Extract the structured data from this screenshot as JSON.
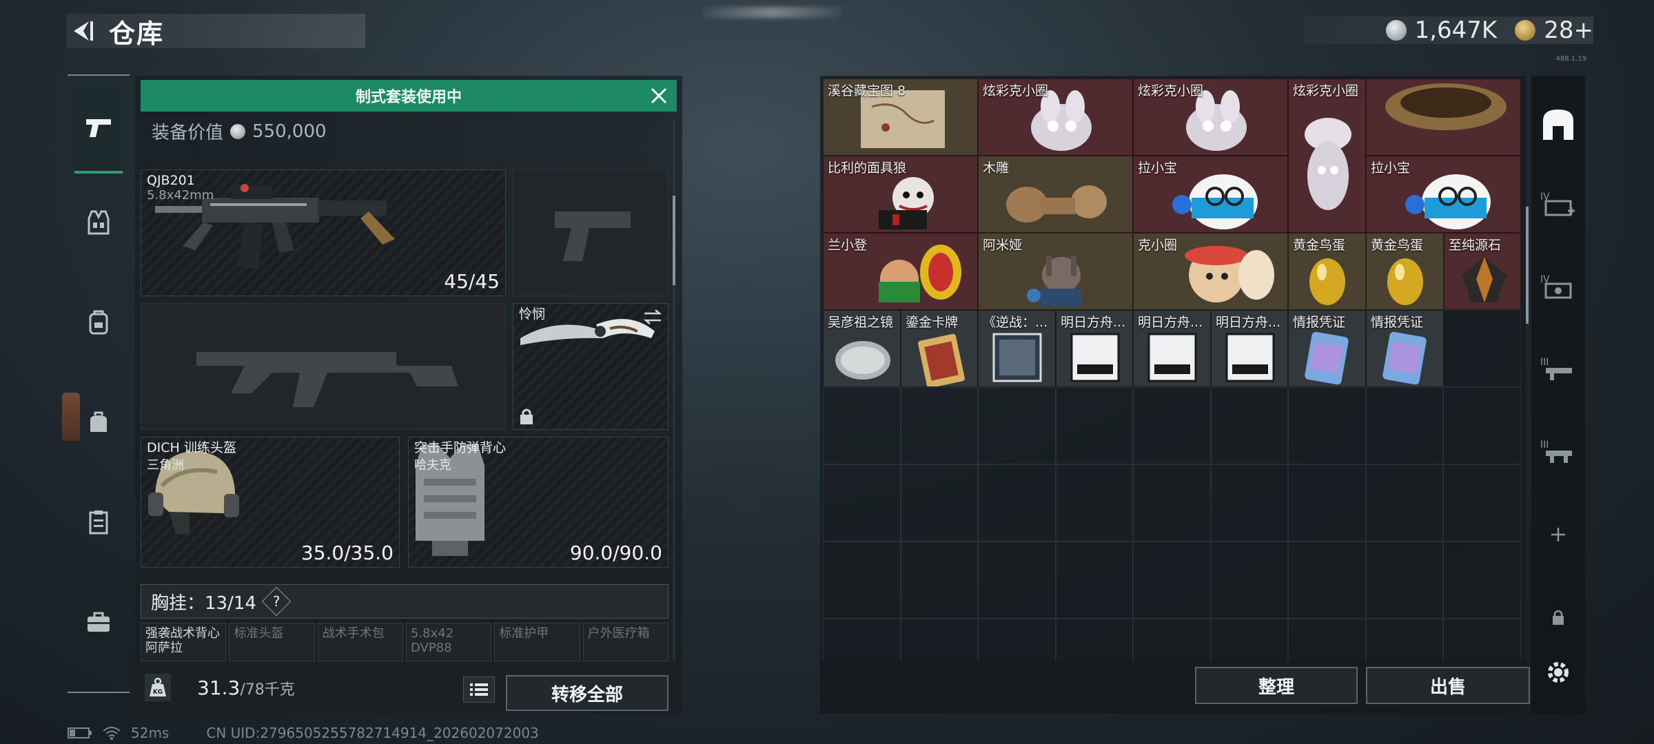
{
  "header": {
    "title": "仓库"
  },
  "currency": {
    "silver": "1,647K",
    "gold": "28+"
  },
  "corner_label": "488.1.19",
  "left_rail": {
    "items": [
      {
        "icon": "pistol-icon",
        "active": true
      },
      {
        "icon": "vest-icon"
      },
      {
        "icon": "backpack-icon"
      },
      {
        "icon": "bag-icon"
      },
      {
        "icon": "clipboard-icon"
      },
      {
        "icon": "toolbox-icon"
      }
    ]
  },
  "equipment": {
    "banner": "制式套装使用中",
    "value_label": "装备价值",
    "value": "550,000",
    "primary_weapon": {
      "name": "QJB201",
      "ammo": "5.8x42mm",
      "count": "45/45"
    },
    "melee": {
      "name": "怜悯"
    },
    "helmet": {
      "name": "DICH 训练头盔",
      "origin": "三角洲",
      "durability": "35.0/35.0"
    },
    "armor": {
      "name": "突击手防弹背心",
      "origin": "哈夫克",
      "durability": "90.0/90.0"
    },
    "chest_rig": {
      "label": "胸挂：13/14",
      "help": "?"
    },
    "chest_items": [
      {
        "label": "强袭战术背心",
        "sub": "阿萨拉",
        "filled": true
      },
      {
        "label": "标准头盔",
        "sub": "",
        "filled": false
      },
      {
        "label": "战术手术包",
        "sub": "",
        "filled": false
      },
      {
        "label": "5.8x42",
        "sub": "DVP88",
        "filled": false
      },
      {
        "label": "标准护甲",
        "sub": "",
        "filled": false
      },
      {
        "label": "户外医疗箱",
        "sub": "",
        "filled": false
      }
    ]
  },
  "footer": {
    "kg_icon": "KG",
    "weight": "31.3",
    "weight_max": "/78千克",
    "transfer_all": "转移全部"
  },
  "storage": {
    "items": [
      {
        "name": "溪谷藏宝图 8"
      },
      {
        "name": "炫彩克小圈"
      },
      {
        "name": "炫彩克小圈"
      },
      {
        "name": "炫彩克小圈"
      },
      {
        "name": ""
      },
      {
        "name": "比利的面具狼"
      },
      {
        "name": "木雕"
      },
      {
        "name": "拉小宝"
      },
      {
        "name": "拉小宝"
      },
      {
        "name": "兰小登"
      },
      {
        "name": "阿米娅"
      },
      {
        "name": "克小圈"
      },
      {
        "name": "黄金鸟蛋"
      },
      {
        "name": "黄金鸟蛋"
      },
      {
        "name": "至纯源石"
      },
      {
        "name": "吴彦祖之镜"
      },
      {
        "name": "鎏金卡牌"
      },
      {
        "name": "《逆战：..."
      },
      {
        "name": "明日方舟..."
      },
      {
        "name": "明日方舟..."
      },
      {
        "name": "明日方舟..."
      },
      {
        "name": "情报凭证"
      },
      {
        "name": "情报凭证"
      }
    ],
    "sort_button": "整理",
    "sell_button": "出售"
  },
  "right_rail": {
    "items": [
      {
        "icon": "stash-icon"
      },
      {
        "icon": "case-iv-icon"
      },
      {
        "icon": "case-iv-b-icon"
      },
      {
        "icon": "case-iii-icon"
      },
      {
        "icon": "case-iii-b-icon"
      },
      {
        "icon": "add-icon"
      },
      {
        "icon": "lock-icon"
      },
      {
        "icon": "settings-icon"
      }
    ]
  },
  "status": {
    "ping": "52ms",
    "uid": "CN UID:2796505255782714914_202602072003"
  }
}
